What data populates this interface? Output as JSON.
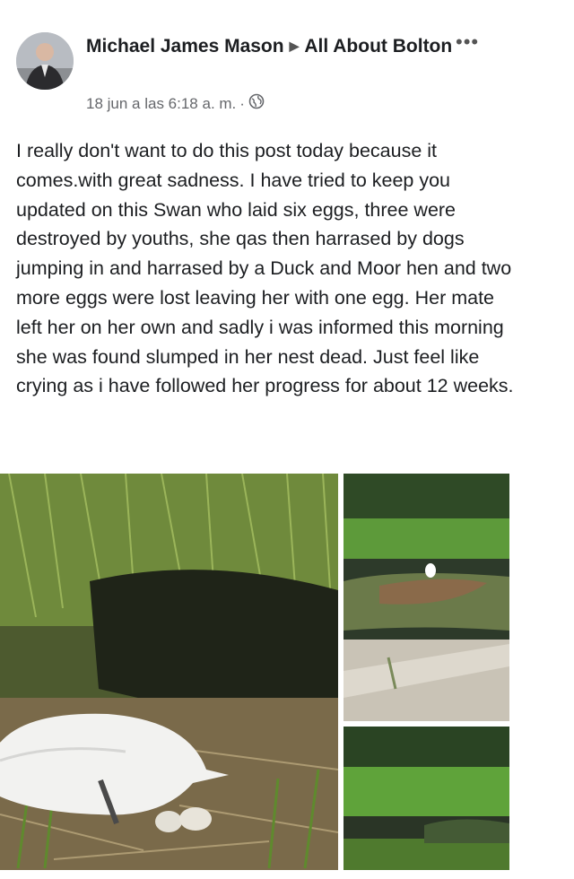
{
  "post": {
    "author": "Michael James Mason",
    "group": "All About Bolton",
    "timestamp": "18 jun a las 6:18 a. m.",
    "separator": "·",
    "audience_icon": "globe-icon",
    "menu_icon": "more-options-icon",
    "body": "I really don't want to do this post today because it comes.with great sadness. I have tried to keep you updated on this Swan who laid six eggs, three were destroyed by youths, she qas then harrased by dogs jumping in and harrased by a Duck and Moor hen and two more eggs were lost leaving her with one egg. Her mate left her on her own and sadly i was informed this morning she was found slumped in her nest dead. Just feel like crying as i have followed her progress for about 12 weeks."
  },
  "photos": [
    {
      "id": "photo-swan-nest"
    },
    {
      "id": "photo-pond-wide"
    },
    {
      "id": "photo-pond-bank"
    }
  ],
  "colors": {
    "text": "#1c1e21",
    "meta": "#65676b"
  }
}
